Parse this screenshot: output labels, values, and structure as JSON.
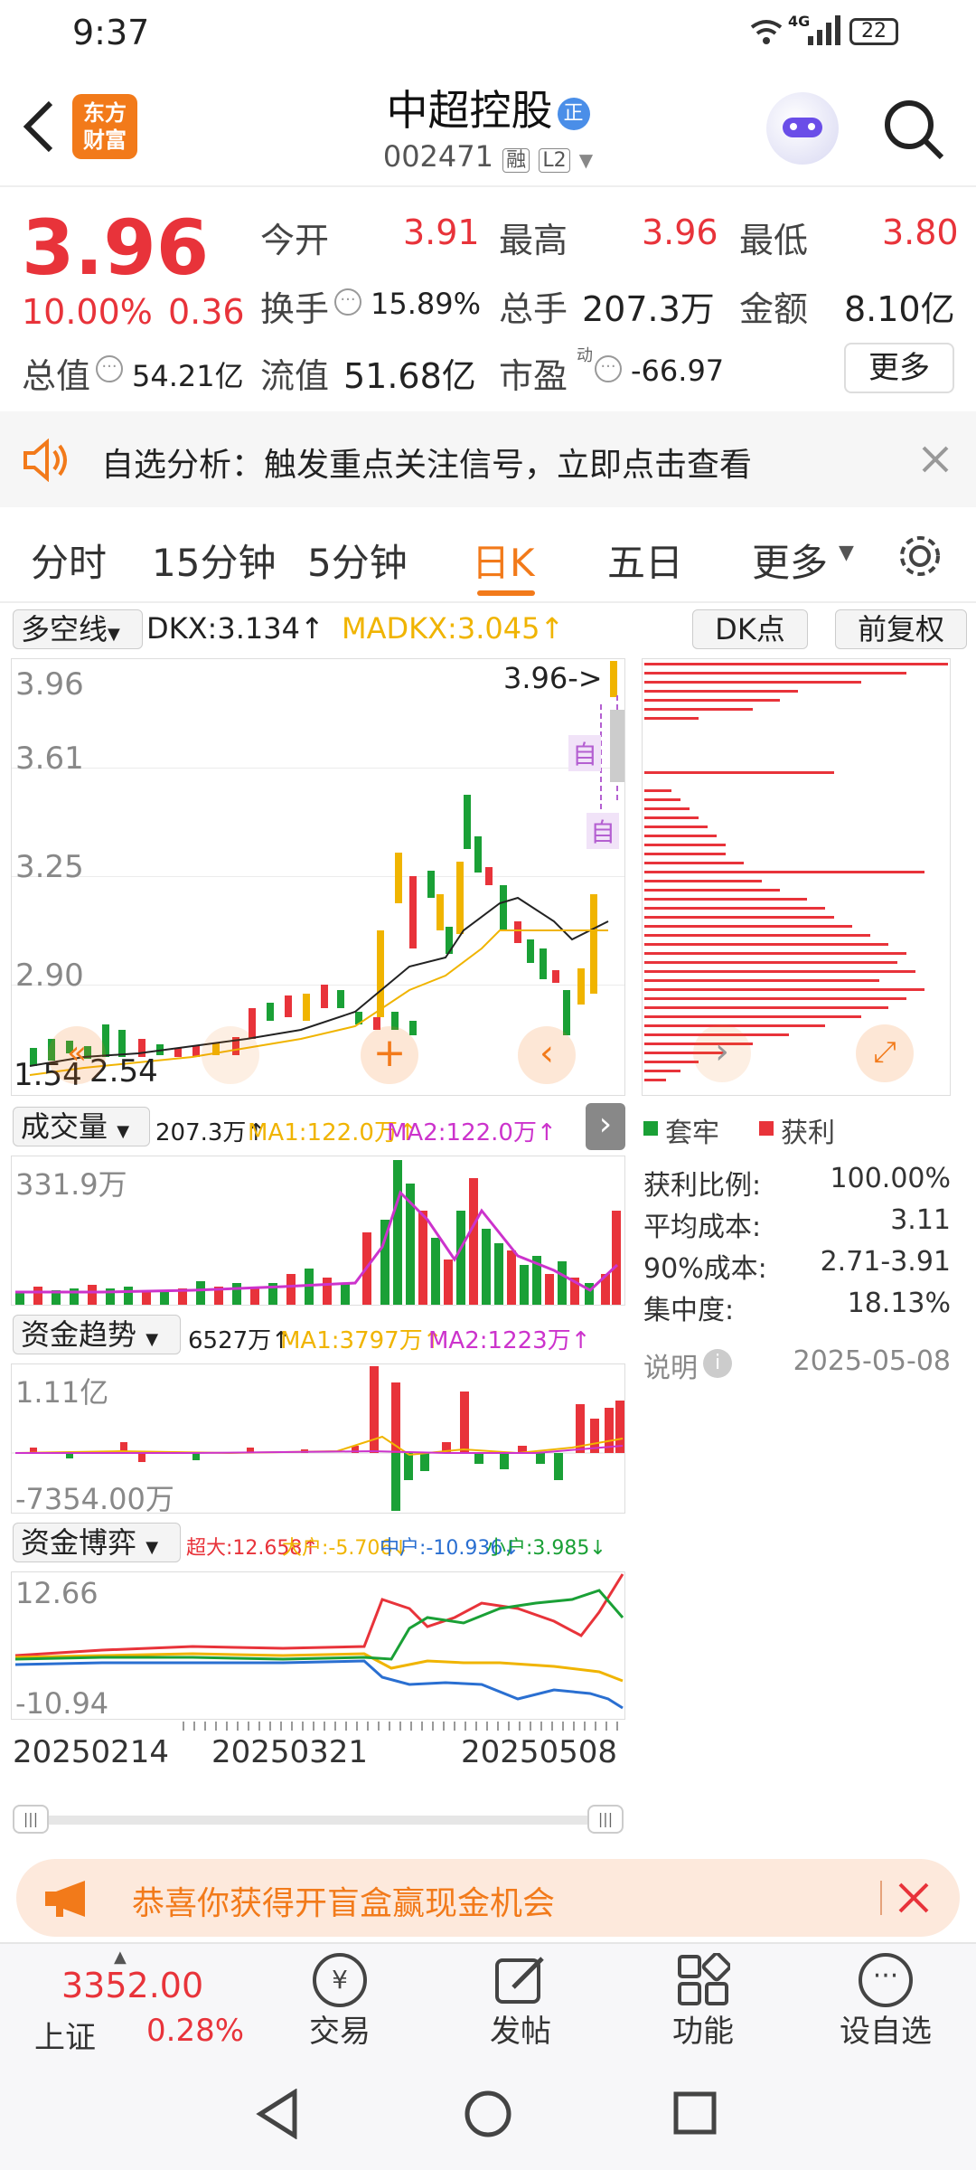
{
  "status": {
    "time": "9:37",
    "network": "4G",
    "battery": "22"
  },
  "header": {
    "brand_line1": "东方",
    "brand_line2": "财富",
    "title": "中超控股",
    "code": "002471",
    "badge_margin": "融",
    "badge_level": "L2"
  },
  "quote": {
    "price": "3.96",
    "change_pct": "10.00%",
    "change": "0.36",
    "open_label": "今开",
    "open": "3.91",
    "high_label": "最高",
    "high": "3.96",
    "low_label": "最低",
    "low": "3.80",
    "turnover_label": "换手",
    "turnover": "15.89%",
    "volume_label": "总手",
    "volume": "207.3万",
    "amount_label": "金额",
    "amount": "8.10亿",
    "mktcap_label": "总值",
    "mktcap": "54.21亿",
    "float_label": "流值",
    "float": "51.68亿",
    "pe_label": "市盈",
    "pe_sup": "动",
    "pe": "-66.97",
    "more_btn": "更多"
  },
  "banner": {
    "text": "自选分析：触发重点关注信号，立即点击查看"
  },
  "tabs": [
    "分时",
    "15分钟",
    "5分钟",
    "日K",
    "五日",
    "更多"
  ],
  "active_tab": 3,
  "indicator": {
    "name": "多空线",
    "dkx": "DKX:3.134↑",
    "madkx": "MADKX:3.045↑",
    "dk_btn": "DK点",
    "fq_btn": "前复权"
  },
  "kchart": {
    "y_ticks": [
      "3.96",
      "3.61",
      "3.25",
      "2.90"
    ],
    "price_tag": "3.96->",
    "low_left": "1.54",
    "low_right": "2.54",
    "marker": "自"
  },
  "volume": {
    "name": "成交量",
    "vol": "207.3万↑",
    "ma1": "MA1:122.0万↑",
    "ma2": "MA2:122.0万↑",
    "max": "331.9万"
  },
  "fund_trend": {
    "name": "资金趋势",
    "val": "6527万↑",
    "ma1": "MA1:3797万↑",
    "ma2": "MA2:1223万↑",
    "max": "1.11亿",
    "min": "-7354.00万"
  },
  "fund_game": {
    "name": "资金博弈",
    "super": "超大:12.658↑",
    "large": "大户:-5.706↓",
    "mid": "中户:-10.936↓",
    "small": "小户:3.985↓",
    "max": "12.66",
    "min": "-10.94"
  },
  "dates": [
    "20250214",
    "20250321",
    "20250508"
  ],
  "chips": {
    "legend_trapped": "套牢",
    "legend_profit": "获利",
    "rows": [
      {
        "label": "获利比例:",
        "value": "100.00%"
      },
      {
        "label": "平均成本:",
        "value": "3.11"
      },
      {
        "label": "90%成本:",
        "value": "2.71-3.91"
      },
      {
        "label": "集中度:",
        "value": "18.13%"
      }
    ],
    "note": "说明",
    "date": "2025-05-08"
  },
  "promo": {
    "text": "恭喜你获得开盲盒赢现金机会"
  },
  "bottom": {
    "index_value": "3352.00",
    "index_name": "上证",
    "index_pct": "0.28%",
    "trade": "交易",
    "post": "发帖",
    "func": "功能",
    "fav": "设自选"
  },
  "colors": {
    "up": "#e8333a",
    "down": "#1aa036",
    "accent": "#f27a1a",
    "ma_yellow": "#f0b400",
    "ma_purple": "#cc33cc"
  }
}
